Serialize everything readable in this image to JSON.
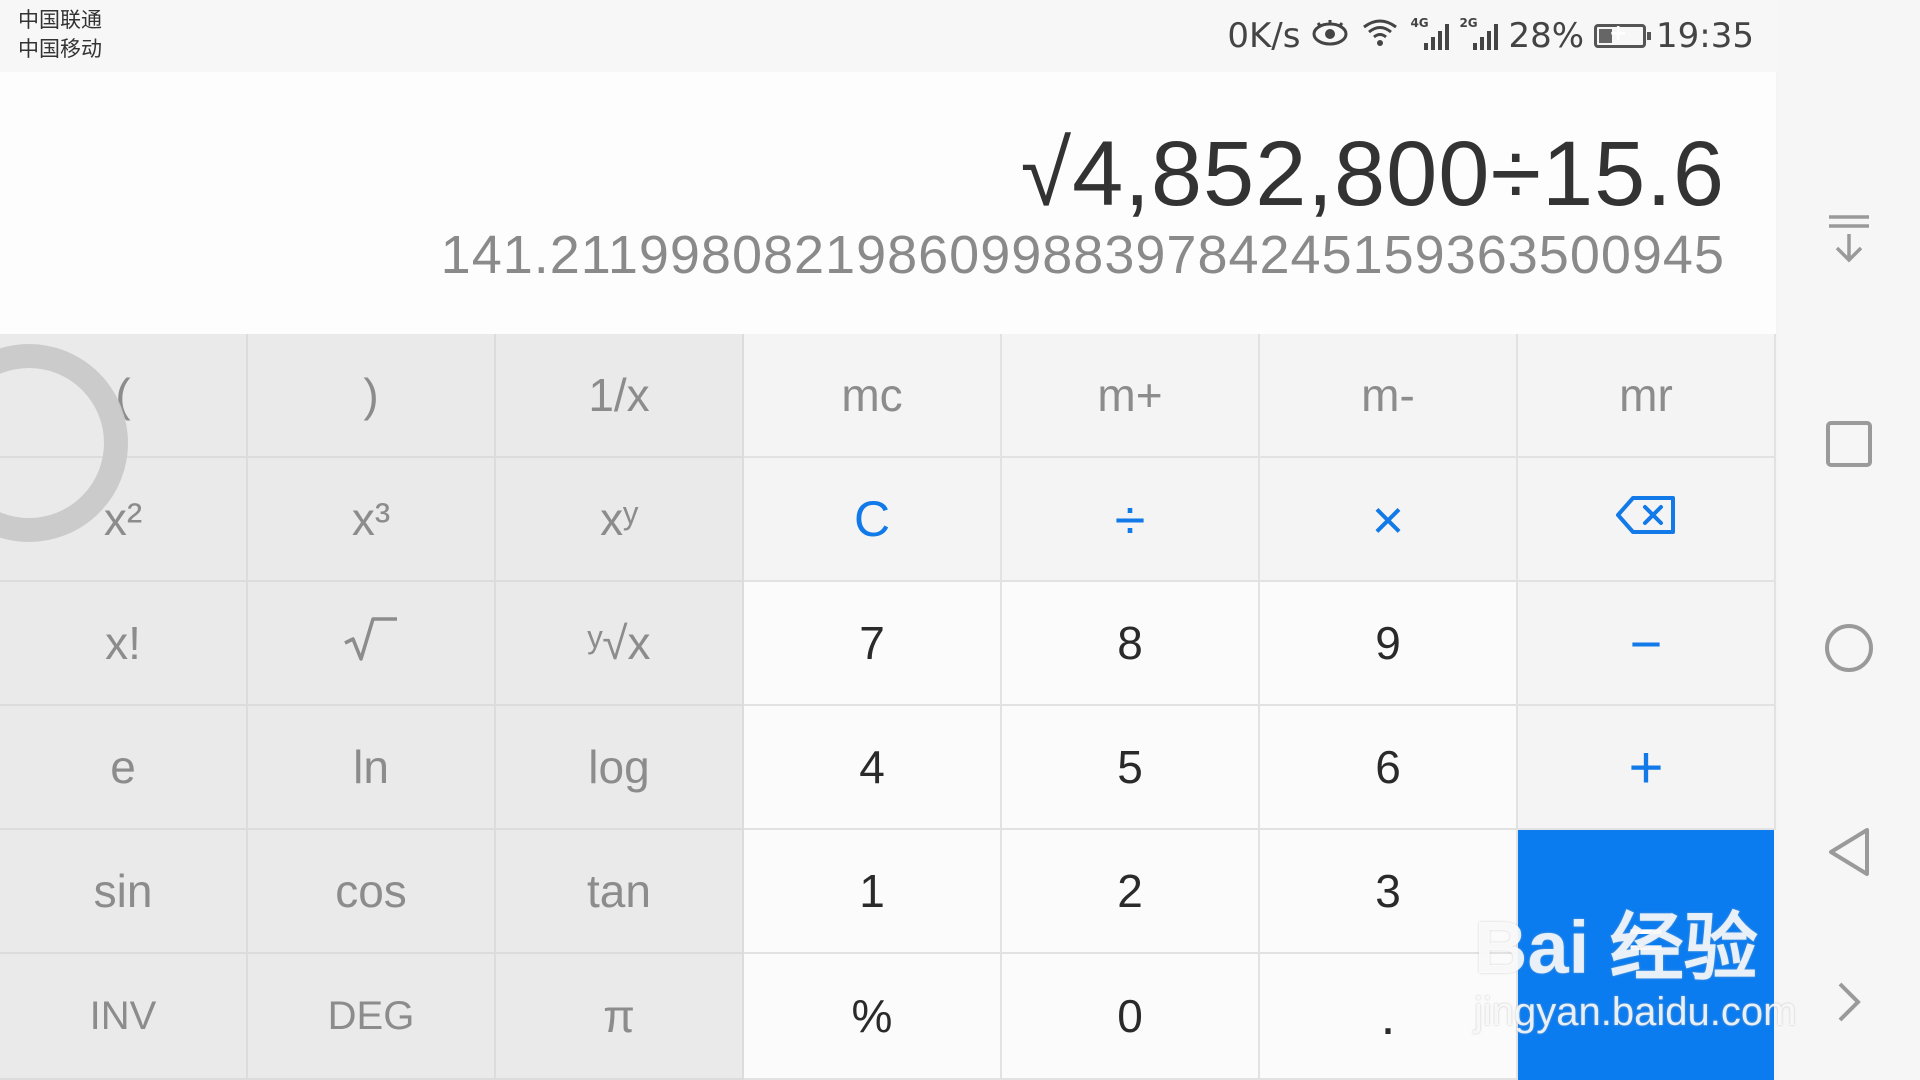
{
  "status_bar": {
    "carrier_1": "中国联通",
    "carrier_2": "中国移动",
    "net_speed": "0K/s",
    "sim1_network": "4G",
    "sim2_network": "2G",
    "battery_percent": "28%",
    "battery_level": 0.28,
    "time": "19:35",
    "icons": [
      "eye-icon",
      "wifi-icon",
      "signal-icon",
      "battery-charging-icon"
    ]
  },
  "display": {
    "expression": "√4,852,800÷15.6",
    "result": "141.21199808219860998839784245159363500945"
  },
  "keypad": {
    "rows": [
      [
        "(",
        ")",
        "1/x",
        "mc",
        "m+",
        "m-",
        "mr"
      ],
      [
        "x²",
        "x³",
        "xʸ",
        "C",
        "÷",
        "×",
        "backspace"
      ],
      [
        "x!",
        "√",
        "ʸ√x",
        "7",
        "8",
        "9",
        "−"
      ],
      [
        "e",
        "ln",
        "log",
        "4",
        "5",
        "6",
        "+"
      ],
      [
        "sin",
        "cos",
        "tan",
        "1",
        "2",
        "3",
        "="
      ],
      [
        "INV",
        "DEG",
        "π",
        "%",
        "0",
        ".",
        ""
      ]
    ]
  },
  "colors": {
    "accent": "#0b7cf0",
    "operator_text": "#1279e8",
    "scientific_bg": "#eaeaea",
    "number_bg": "#fbfbfb"
  },
  "nav_bar": {
    "icons": [
      "notification-pull-down-icon",
      "recent-apps-icon",
      "home-icon",
      "back-icon",
      "expand-icon"
    ]
  },
  "watermark": {
    "logo": "Bai 经验",
    "url": "jingyan.baidu.com"
  }
}
